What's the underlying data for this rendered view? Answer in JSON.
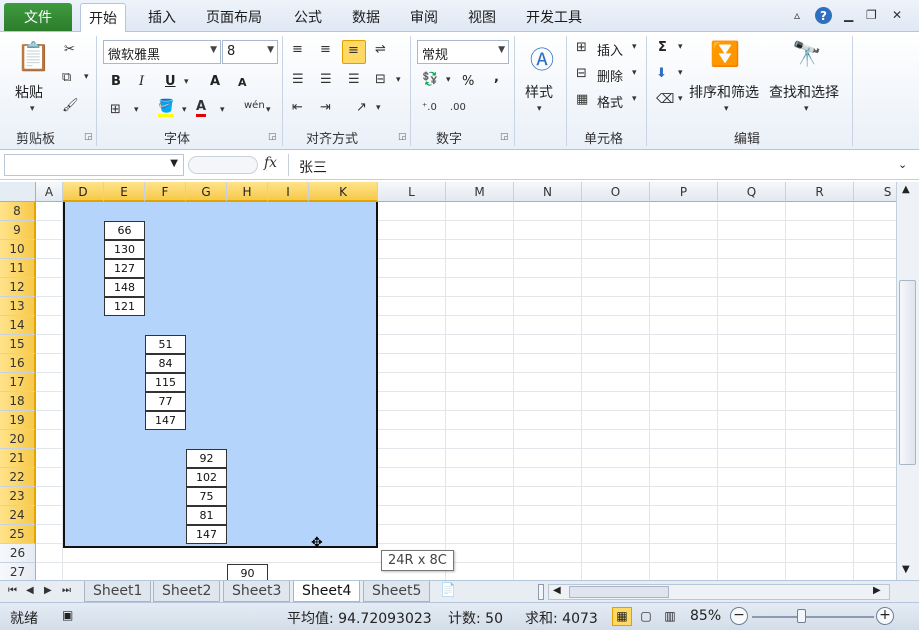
{
  "tabs": {
    "file": "文件",
    "items": [
      "开始",
      "插入",
      "页面布局",
      "公式",
      "数据",
      "审阅",
      "视图",
      "开发工具"
    ]
  },
  "ribbon": {
    "clipboard": {
      "paste": "粘贴",
      "label": "剪贴板"
    },
    "font": {
      "name": "微软雅黑",
      "size": "8",
      "bold": "B",
      "italic": "I",
      "underline": "U",
      "grow": "A",
      "shrink": "A",
      "label": "字体"
    },
    "alignment": {
      "label": "对齐方式"
    },
    "number": {
      "format": "常规",
      "percent": "%",
      "comma": ",",
      "label": "数字"
    },
    "styles": {
      "styles": "样式"
    },
    "cells": {
      "insert": "插入",
      "delete": "删除",
      "format": "格式",
      "label": "单元格"
    },
    "editing": {
      "sum": "Σ",
      "sort_filter": "排序和筛选",
      "find_select": "查找和选择",
      "label": "编辑"
    }
  },
  "formula_bar": {
    "name_box": "",
    "fx": "fx",
    "content": "张三"
  },
  "columns": [
    "A",
    "D",
    "E",
    "F",
    "G",
    "H",
    "I",
    "K",
    "L",
    "M",
    "N",
    "O",
    "P",
    "Q",
    "R",
    "S"
  ],
  "rows": [
    "8",
    "9",
    "10",
    "11",
    "12",
    "13",
    "14",
    "15",
    "16",
    "17",
    "18",
    "19",
    "20",
    "21",
    "22",
    "23",
    "24",
    "25",
    "26",
    "27"
  ],
  "blocks": {
    "e": [
      "66",
      "130",
      "127",
      "148",
      "121"
    ],
    "f": [
      "51",
      "84",
      "115",
      "77",
      "147"
    ],
    "g": [
      "92",
      "102",
      "75",
      "81",
      "147"
    ],
    "h_row27": "90"
  },
  "tooltip": "24R x 8C",
  "sheets": [
    "Sheet1",
    "Sheet2",
    "Sheet3",
    "Sheet4",
    "Sheet5"
  ],
  "active_sheet": "Sheet4",
  "status": {
    "mode": "就绪",
    "average": "平均值: 94.72093023",
    "count": "计数: 50",
    "sum": "求和: 4073",
    "zoom": "85%"
  }
}
